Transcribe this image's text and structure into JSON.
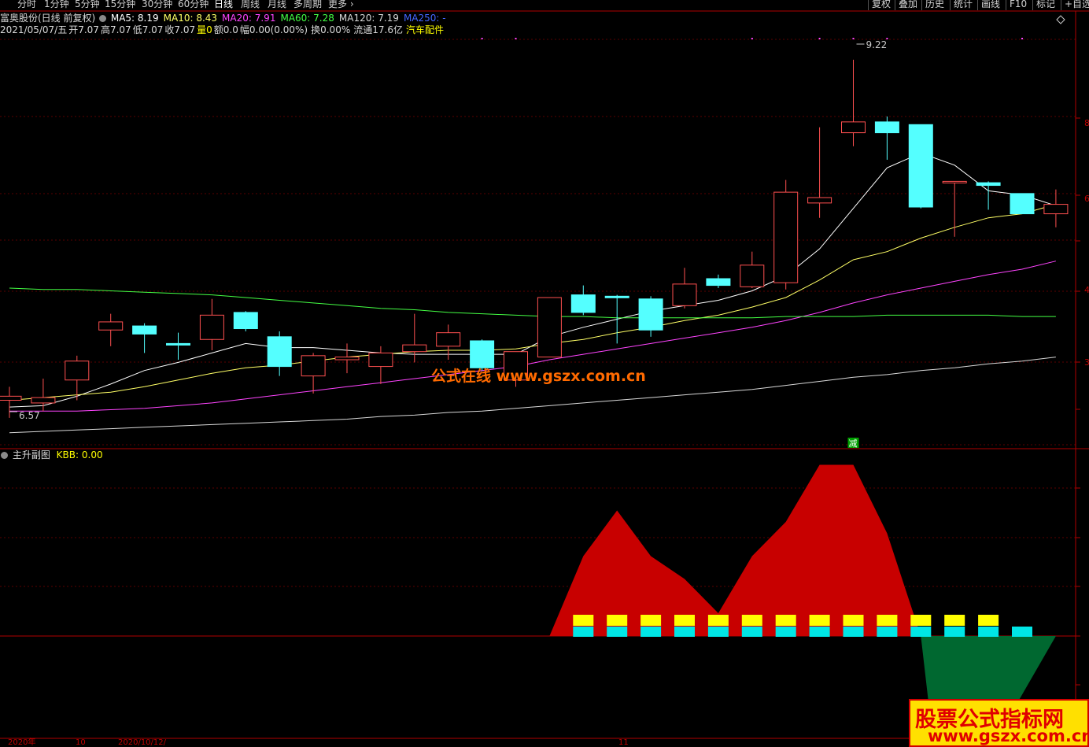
{
  "toolbar": {
    "items": [
      "分时",
      "1分钟",
      "5分钟",
      "15分钟",
      "30分钟",
      "60分钟",
      "日线",
      "周线",
      "月线",
      "多周期",
      "更多"
    ],
    "more_arrow": "›",
    "right_items": [
      "复权",
      "叠加",
      "历史",
      "统计",
      "画线",
      "F10",
      "标记",
      "+自选"
    ]
  },
  "info": {
    "stock": "富奥股份(日线 前复权)",
    "ma": [
      {
        "label": "MA5: 8.19",
        "color": "#ffffff"
      },
      {
        "label": "MA10: 8.43",
        "color": "#ffff66"
      },
      {
        "label": "MA20: 7.91",
        "color": "#ff44ff"
      },
      {
        "label": "MA60: 7.28",
        "color": "#44ff44"
      },
      {
        "label": "MA120: 7.19",
        "color": "#d8d8d8"
      },
      {
        "label": "MA250: -",
        "color": "#4466ff"
      }
    ]
  },
  "quote": {
    "date": "2021/05/07/五",
    "open": "开7.07",
    "high": "高7.07",
    "low": "低7.07",
    "close": "收7.07",
    "volume": "量0",
    "amount": "额0.0",
    "change": "幅0.00(0.00%)",
    "turnover": "换0.00%",
    "float": "流通17.6亿",
    "industry": "汽车配件"
  },
  "subchart": {
    "title": "主升副图",
    "kbb": "KBB: 0.00"
  },
  "watermark": "公式在线 www.gszx.com.cn",
  "badge": {
    "title": "股票公式指标网",
    "url": "www.gszx.com.cn"
  },
  "date_axis": [
    "2020年",
    "10",
    "2020/10/12/",
    "11"
  ],
  "chart_data": {
    "type": "candlestick",
    "annotations": {
      "high": "9.22",
      "low": "6.57",
      "sell_marker": "减"
    },
    "y_axis_labels": [
      "8",
      "6",
      "4",
      "3",
      "1"
    ],
    "candles": [
      {
        "o": 6.7,
        "h": 6.8,
        "l": 6.57,
        "c": 6.73
      },
      {
        "o": 6.68,
        "h": 6.86,
        "l": 6.62,
        "c": 6.72
      },
      {
        "o": 6.85,
        "h": 7.03,
        "l": 6.7,
        "c": 6.99
      },
      {
        "o": 7.22,
        "h": 7.34,
        "l": 7.1,
        "c": 7.28
      },
      {
        "o": 7.25,
        "h": 7.27,
        "l": 7.05,
        "c": 7.19
      },
      {
        "o": 7.12,
        "h": 7.2,
        "l": 7.0,
        "c": 7.11
      },
      {
        "o": 7.15,
        "h": 7.45,
        "l": 7.07,
        "c": 7.33
      },
      {
        "o": 7.35,
        "h": 7.36,
        "l": 7.21,
        "c": 7.23
      },
      {
        "o": 7.17,
        "h": 7.21,
        "l": 6.88,
        "c": 6.95
      },
      {
        "o": 6.88,
        "h": 7.05,
        "l": 6.75,
        "c": 7.03
      },
      {
        "o": 7.0,
        "h": 7.12,
        "l": 6.9,
        "c": 7.02
      },
      {
        "o": 6.95,
        "h": 7.1,
        "l": 6.82,
        "c": 7.05
      },
      {
        "o": 7.06,
        "h": 7.34,
        "l": 6.98,
        "c": 7.11
      },
      {
        "o": 7.1,
        "h": 7.26,
        "l": 7.0,
        "c": 7.2
      },
      {
        "o": 7.14,
        "h": 7.15,
        "l": 6.92,
        "c": 6.94
      },
      {
        "o": 6.85,
        "h": 7.06,
        "l": 6.8,
        "c": 7.06
      },
      {
        "o": 7.02,
        "h": 7.46,
        "l": 7.02,
        "c": 7.46
      },
      {
        "o": 7.48,
        "h": 7.55,
        "l": 7.33,
        "c": 7.35
      },
      {
        "o": 7.47,
        "h": 7.48,
        "l": 7.12,
        "c": 7.46
      },
      {
        "o": 7.45,
        "h": 7.47,
        "l": 7.17,
        "c": 7.22
      },
      {
        "o": 7.4,
        "h": 7.68,
        "l": 7.38,
        "c": 7.56
      },
      {
        "o": 7.6,
        "h": 7.63,
        "l": 7.53,
        "c": 7.55
      },
      {
        "o": 7.54,
        "h": 7.8,
        "l": 7.53,
        "c": 7.7
      },
      {
        "o": 7.57,
        "h": 8.33,
        "l": 7.52,
        "c": 8.24
      },
      {
        "o": 8.16,
        "h": 8.72,
        "l": 8.05,
        "c": 8.2
      },
      {
        "o": 8.68,
        "h": 9.22,
        "l": 8.58,
        "c": 8.76
      },
      {
        "o": 8.76,
        "h": 8.8,
        "l": 8.48,
        "c": 8.68
      },
      {
        "o": 8.74,
        "h": 8.74,
        "l": 8.12,
        "c": 8.13
      },
      {
        "o": 8.32,
        "h": 8.32,
        "l": 7.91,
        "c": 8.32
      },
      {
        "o": 8.31,
        "h": 8.32,
        "l": 8.11,
        "c": 8.29
      },
      {
        "o": 8.23,
        "h": 8.2,
        "l": 8.1,
        "c": 8.08
      },
      {
        "o": 8.08,
        "h": 8.26,
        "l": 7.98,
        "c": 8.15
      }
    ],
    "ma_series": [
      {
        "name": "MA5",
        "color": "#ffffff",
        "values": [
          6.65,
          6.66,
          6.73,
          6.82,
          6.92,
          6.98,
          7.05,
          7.12,
          7.09,
          7.09,
          7.07,
          7.05,
          7.04,
          7.04,
          7.04,
          7.04,
          7.17,
          7.24,
          7.3,
          7.36,
          7.4,
          7.44,
          7.51,
          7.62,
          7.82,
          8.12,
          8.42,
          8.53,
          8.44,
          8.25,
          8.22,
          8.14
        ]
      },
      {
        "name": "MA10",
        "color": "#ffff66",
        "values": [
          6.7,
          6.72,
          6.74,
          6.76,
          6.8,
          6.85,
          6.9,
          6.94,
          6.96,
          6.99,
          7.02,
          7.04,
          7.06,
          7.07,
          7.07,
          7.08,
          7.12,
          7.15,
          7.2,
          7.24,
          7.29,
          7.33,
          7.39,
          7.46,
          7.59,
          7.74,
          7.8,
          7.9,
          7.98,
          8.05,
          8.08,
          8.15
        ]
      },
      {
        "name": "MA20",
        "color": "#ff44ff",
        "values": [
          6.62,
          6.62,
          6.62,
          6.63,
          6.64,
          6.66,
          6.68,
          6.71,
          6.74,
          6.77,
          6.8,
          6.83,
          6.86,
          6.89,
          6.92,
          6.95,
          7.0,
          7.04,
          7.08,
          7.12,
          7.16,
          7.2,
          7.24,
          7.29,
          7.35,
          7.42,
          7.48,
          7.53,
          7.58,
          7.63,
          7.67,
          7.73
        ]
      },
      {
        "name": "MA60",
        "color": "#44ff44",
        "values": [
          7.53,
          7.52,
          7.52,
          7.51,
          7.5,
          7.49,
          7.48,
          7.46,
          7.44,
          7.42,
          7.4,
          7.38,
          7.37,
          7.35,
          7.34,
          7.33,
          7.32,
          7.32,
          7.31,
          7.31,
          7.31,
          7.31,
          7.31,
          7.32,
          7.32,
          7.32,
          7.33,
          7.33,
          7.33,
          7.33,
          7.32,
          7.32
        ]
      },
      {
        "name": "MA120",
        "color": "#d8d8d8",
        "values": [
          6.46,
          6.47,
          6.48,
          6.49,
          6.5,
          6.51,
          6.52,
          6.53,
          6.54,
          6.55,
          6.56,
          6.58,
          6.59,
          6.61,
          6.62,
          6.64,
          6.66,
          6.68,
          6.7,
          6.72,
          6.74,
          6.76,
          6.78,
          6.81,
          6.84,
          6.87,
          6.89,
          6.92,
          6.94,
          6.97,
          6.99,
          7.02
        ]
      }
    ],
    "sub_area": [
      0,
      0,
      0,
      0,
      0,
      0,
      0,
      0,
      0,
      0,
      0,
      0,
      0,
      0,
      0,
      0,
      0,
      35,
      55,
      35,
      25,
      10,
      35,
      50,
      75,
      75,
      45,
      -35,
      -35,
      -35,
      -35,
      -35
    ],
    "sub_blocks_yellow": [
      false,
      false,
      false,
      false,
      false,
      false,
      false,
      false,
      false,
      false,
      false,
      false,
      false,
      false,
      false,
      false,
      false,
      true,
      true,
      true,
      true,
      true,
      true,
      true,
      true,
      true,
      true,
      true,
      true,
      true,
      false,
      false
    ],
    "sub_blocks_cyan": [
      false,
      false,
      false,
      false,
      false,
      false,
      false,
      false,
      false,
      false,
      false,
      false,
      false,
      false,
      false,
      false,
      false,
      true,
      true,
      true,
      true,
      true,
      true,
      true,
      true,
      true,
      true,
      true,
      true,
      true,
      true,
      false
    ]
  }
}
